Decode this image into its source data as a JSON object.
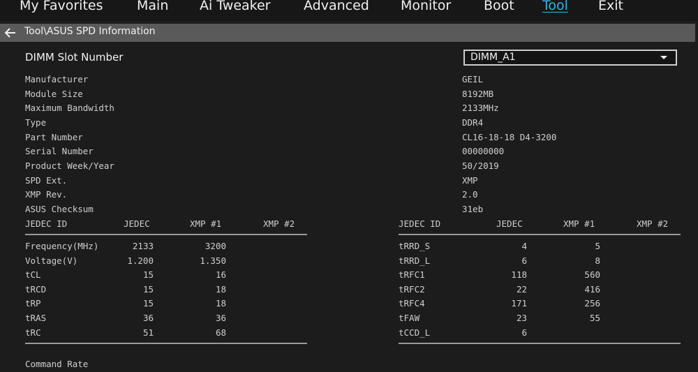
{
  "nav": {
    "tabs": [
      {
        "label": "My Favorites"
      },
      {
        "label": "Main"
      },
      {
        "label": "Ai Tweaker"
      },
      {
        "label": "Advanced"
      },
      {
        "label": "Monitor"
      },
      {
        "label": "Boot"
      },
      {
        "label": "Tool"
      },
      {
        "label": "Exit"
      }
    ],
    "active_tab": "Tool"
  },
  "breadcrumb": "Tool\\ASUS SPD Information",
  "slot": {
    "label": "DIMM Slot Number",
    "selected": "DIMM_A1"
  },
  "info": [
    {
      "label": "Manufacturer",
      "value": "GEIL"
    },
    {
      "label": "Module Size",
      "value": "8192MB"
    },
    {
      "label": "Maximum Bandwidth",
      "value": "2133MHz"
    },
    {
      "label": "Type",
      "value": "DDR4"
    },
    {
      "label": "Part Number",
      "value": "CL16-18-18 D4-3200"
    },
    {
      "label": "Serial Number",
      "value": "00000000"
    },
    {
      "label": "Product Week/Year",
      "value": "50/2019"
    },
    {
      "label": "SPD Ext.",
      "value": "XMP"
    },
    {
      "label": "XMP Rev.",
      "value": "2.0"
    },
    {
      "label": "ASUS Checksum",
      "value": "31eb"
    }
  ],
  "timings": {
    "left": {
      "headers": [
        "JEDEC ID",
        "JEDEC",
        "XMP #1",
        "XMP #2"
      ],
      "rows": [
        {
          "name": "Frequency(MHz)",
          "jedec": "2133",
          "xmp1": "3200",
          "xmp2": ""
        },
        {
          "name": "Voltage(V)",
          "jedec": "1.200",
          "xmp1": "1.350",
          "xmp2": ""
        },
        {
          "name": "tCL",
          "jedec": "15",
          "xmp1": "16",
          "xmp2": ""
        },
        {
          "name": "tRCD",
          "jedec": "15",
          "xmp1": "18",
          "xmp2": ""
        },
        {
          "name": "tRP",
          "jedec": "15",
          "xmp1": "18",
          "xmp2": ""
        },
        {
          "name": "tRAS",
          "jedec": "36",
          "xmp1": "36",
          "xmp2": ""
        },
        {
          "name": "tRC",
          "jedec": "51",
          "xmp1": "68",
          "xmp2": ""
        }
      ]
    },
    "right": {
      "headers": [
        "JEDEC ID",
        "JEDEC",
        "XMP #1",
        "XMP #2"
      ],
      "rows": [
        {
          "name": "tRRD_S",
          "jedec": "4",
          "xmp1": "5",
          "xmp2": ""
        },
        {
          "name": "tRRD_L",
          "jedec": "6",
          "xmp1": "8",
          "xmp2": ""
        },
        {
          "name": "tRFC1",
          "jedec": "118",
          "xmp1": "560",
          "xmp2": ""
        },
        {
          "name": "tRFC2",
          "jedec": "22",
          "xmp1": "416",
          "xmp2": ""
        },
        {
          "name": "tRFC4",
          "jedec": "171",
          "xmp1": "256",
          "xmp2": ""
        },
        {
          "name": "tFAW",
          "jedec": "23",
          "xmp1": "55",
          "xmp2": ""
        },
        {
          "name": "tCCD_L",
          "jedec": "6",
          "xmp1": "",
          "xmp2": ""
        }
      ]
    }
  },
  "command_rate_label": "Command Rate",
  "colors": {
    "background": "#1c1c1c",
    "active_tab": "#2fb6e8",
    "breadcrumb_bar": "#5a5a5a"
  }
}
